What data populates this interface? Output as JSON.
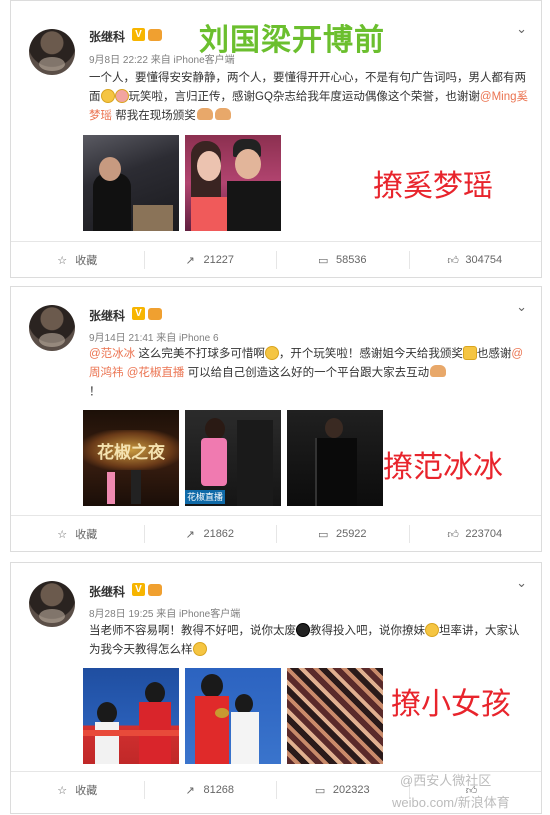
{
  "posts": [
    {
      "username": "张继科",
      "time": "9月8日 22:22",
      "source": "来自 iPhone客户端",
      "text_parts": [
        "一个人，要懂得安安静静，两个人，要懂得开开心心，不是有句广告词吗，男人都有两面",
        "玩笑啦，言归正传，感谢GQ杂志给我年度运动偶像这个荣誉，也谢谢",
        "@Ming奚梦瑶",
        " 帮我在现场颁奖"
      ],
      "actions": {
        "fav": "收藏",
        "repost": "21227",
        "comment": "58536",
        "like": "304754"
      },
      "overlay_title": "刘国梁开博前",
      "overlay_caption": "撩奚梦瑶"
    },
    {
      "username": "张继科",
      "time": "9月14日 21:41",
      "source": "来自 iPhone 6",
      "text_parts": [
        "@范冰冰",
        " 这么完美不打球多可惜啊",
        "，开个玩笑啦！感谢姐今天给我颁奖",
        "也感谢",
        "@周鸿祎",
        " ",
        "@花椒直播",
        " 可以给自己创造这么好的一个平台跟大家去互动",
        "！"
      ],
      "photo_text": [
        "花椒之夜",
        "花椒直播"
      ],
      "actions": {
        "fav": "收藏",
        "repost": "21862",
        "comment": "25922",
        "like": "223704"
      },
      "overlay_caption": "撩范冰冰"
    },
    {
      "username": "张继科",
      "time": "8月28日 19:25",
      "source": "来自 iPhone客户端",
      "text_parts": [
        "当老师不容易啊！教得不好吧，说你太废",
        "教得投入吧，说你撩妹",
        "坦率讲，大家认为我今天教得怎么样"
      ],
      "actions": {
        "fav": "收藏",
        "repost": "81268",
        "comment": "202323",
        "like": ""
      },
      "overlay_caption": "撩小女孩"
    }
  ],
  "watermark": {
    "line1": "@西安人微社区",
    "line2": "weibo.com/新浪体育"
  }
}
